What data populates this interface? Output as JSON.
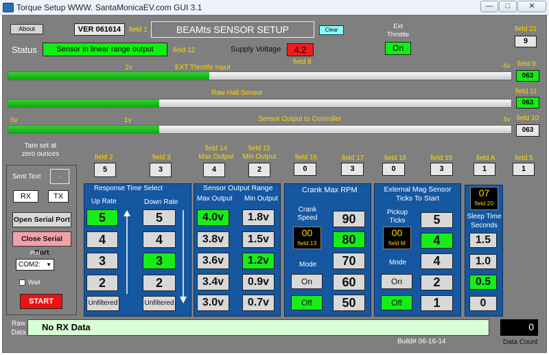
{
  "window": {
    "title": "Torque Setup WWW. SantaMonicaEV.com     GUI 3.1",
    "minimize": "—",
    "maximize": "□",
    "close": "✕"
  },
  "header": {
    "about_label": "About",
    "version": "VER 061614",
    "field1": "field 1",
    "title": "BEAMts   SENSOR SETUP",
    "clear_label": "Clear",
    "ext_throttle_label": "Ext\nThrottle",
    "ext_throttle_value": "On",
    "field21_label": "field 21",
    "field21_value": "9"
  },
  "status": {
    "label": "Status",
    "value": "Sensor in linear range output",
    "field12": "field 12",
    "supply_label": "Supply Voltage",
    "supply_value": "4.2",
    "field8": "field 8"
  },
  "bars": {
    "ext_throttle": {
      "title": "EXT Throttle Input",
      "left_tick": "1v",
      "right_tick": "4v",
      "field_label": "field 9",
      "value": "063",
      "fill": 0.4
    },
    "raw_hall": {
      "title": "Raw Hall Sensor",
      "field_label": "field 11",
      "value": "063",
      "fill": 0.3
    },
    "sensor_output": {
      "title": "Sensor Output to Controller",
      "tick_0": "0v",
      "tick_1": "1v",
      "tick_4": "4v",
      "field_label": "field 10",
      "value": "063",
      "fill": 0.3
    }
  },
  "tare": "Tare set at\nzero ounces",
  "fields_row": [
    {
      "label": "field 2",
      "value": "5"
    },
    {
      "label": "field 3",
      "value": "3"
    },
    {
      "label": "field 14\nMax Output",
      "value": "4"
    },
    {
      "label": "field 15\nMin Output",
      "value": "2"
    },
    {
      "label": "field 16",
      "value": "0"
    },
    {
      "label": "field 17",
      "value": "3"
    },
    {
      "label": "field 18",
      "value": "0"
    },
    {
      "label": "field 19",
      "value": "3"
    },
    {
      "label": "field A",
      "value": "1"
    },
    {
      "label": "field 5",
      "value": "1"
    }
  ],
  "left_panel": {
    "sent_text_label": "Sent Text",
    "sent_text_value": "-",
    "rx_label": "RX",
    "tx_label": "TX",
    "open_serial": "Open Serial Port",
    "close_serial": "Close Serial Port",
    "port_label": "Port",
    "port_value": "COM2:",
    "wait_label": "Wait",
    "start_label": "START"
  },
  "response": {
    "title": "Response     Time     Select",
    "up_label": "Up Rate",
    "down_label": "Down Rate",
    "up": [
      "5",
      "4",
      "3",
      "2"
    ],
    "down": [
      "5",
      "4",
      "3",
      "2"
    ],
    "up_selected": "5",
    "down_selected": "3",
    "unfiltered_up": "Unfiltered",
    "unfiltered_down": "Unfiltered"
  },
  "output_range": {
    "title": "Sensor Output Range",
    "max_label": "Max Output",
    "min_label": "Min Output",
    "max": [
      "4.0v",
      "3.8v",
      "3.6v",
      "3.4v",
      "3.0v"
    ],
    "min": [
      "1.8v",
      "1.5v",
      "1.2v",
      "0.9v",
      "0.7v"
    ],
    "max_selected": "4.0v",
    "min_selected": "1.2v"
  },
  "crank": {
    "title": "Crank Max RPM",
    "speed_label": "Crank\nSpeed",
    "speed_value": "00",
    "speed_field": "field 13",
    "mode_label": "Mode",
    "on_label": "On",
    "off_label": "Off",
    "rpm": [
      "90",
      "80",
      "70",
      "60",
      "50"
    ],
    "rpm_selected": "80"
  },
  "mag": {
    "title": "External Mag Sensor\nTicks To Start",
    "pickup_label": "Pickup\nTicks",
    "pickup_value": "00",
    "pickup_field": "field M",
    "mode_label": "Mode",
    "on_label": "On",
    "off_label": "Off",
    "ticks": [
      "5",
      "4",
      "4",
      "2",
      "1"
    ],
    "ticks_selected_index": 1
  },
  "sleep": {
    "value": "07",
    "field": "field 20",
    "label": "Sleep Time\nSeconds",
    "options": [
      "1.5",
      "1.0",
      "0.5",
      "0"
    ],
    "selected": "0.5"
  },
  "footer": {
    "raw_label": "Raw\nData",
    "raw_value": "No RX Data",
    "build": "Build# 06-16-14",
    "count_value": "0",
    "count_label": "Data Count"
  }
}
